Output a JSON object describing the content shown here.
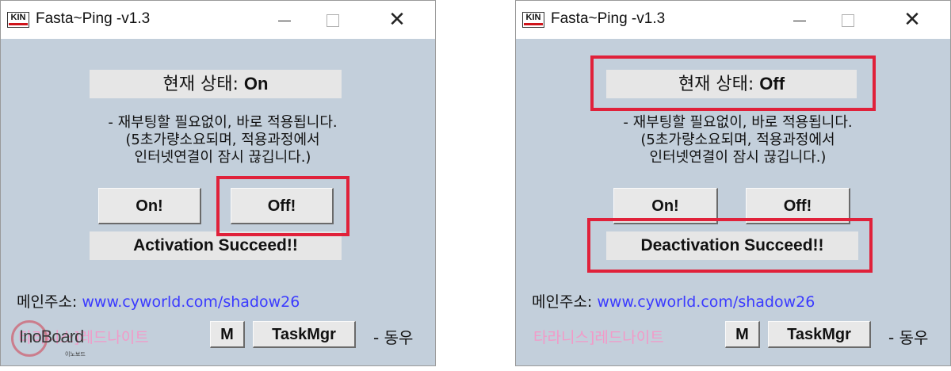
{
  "colors": {
    "window_bg": "#c3cfdb",
    "link": "#3a3aff",
    "credit": "#f29ac8",
    "highlight": "#e0213a"
  },
  "left": {
    "title": "Fasta~Ping  -v1.3",
    "status_label": "현재 상태: ",
    "status_value": "On",
    "note": "- 재부팅할 필요없이, 바로 적용됩니다.\n(5초가량소요되며, 적용과정에서\n인터넷연결이 잠시 끊깁니다.)",
    "on_label": "On!",
    "off_label": "Off!",
    "message": "Activation Succeed!!",
    "addr_label": "메인주소: ",
    "addr_link": "www.cyworld.com/shadow26",
    "credit": "타라니스]레드나이트",
    "m_label": "M",
    "taskmgr_label": "TaskMgr",
    "signature": "- 동우"
  },
  "right": {
    "title": "Fasta~Ping  -v1.3",
    "status_label": "현재 상태: ",
    "status_value": "Off",
    "note": "- 재부팅할 필요없이, 바로 적용됩니다.\n(5초가량소요되며, 적용과정에서\n인터넷연결이 잠시 끊깁니다.)",
    "on_label": "On!",
    "off_label": "Off!",
    "message": "Deactivation Succeed!!",
    "addr_label": "메인주소: ",
    "addr_link": "www.cyworld.com/shadow26",
    "credit": "타라니스]레드나이트",
    "m_label": "M",
    "taskmgr_label": "TaskMgr",
    "signature": "- 동우"
  },
  "app_logo_text": "KIN",
  "watermark": {
    "text": "InoBoard",
    "sub": "이노보드"
  }
}
